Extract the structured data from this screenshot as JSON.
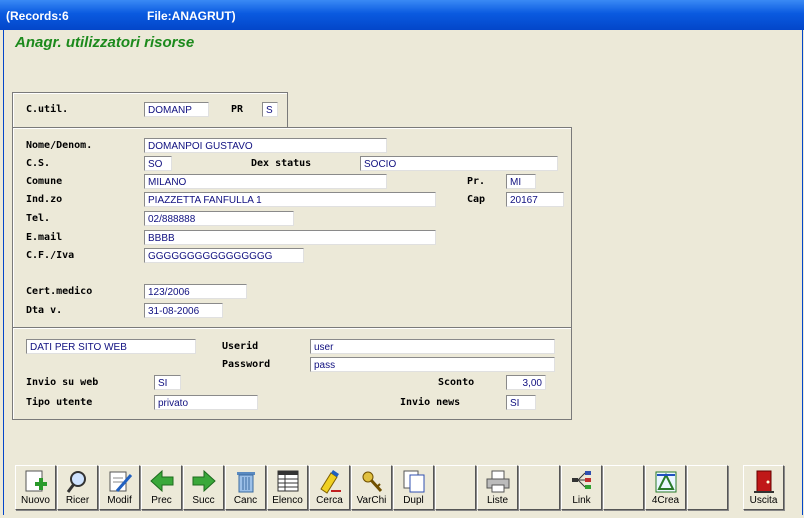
{
  "titlebar": {
    "records": "(Records:6",
    "file": "File:ANAGRUT)"
  },
  "app_title": "Anagr. utilizzatori risorse",
  "header": {
    "cutil_label": "C.util.",
    "cutil_value": "DOMANP",
    "pr_label": "PR",
    "pr_value": "S"
  },
  "main": {
    "nome_label": "Nome/Denom.",
    "nome_value": "DOMANPOI GUSTAVO",
    "cs_label": "C.S.",
    "cs_value": "SO",
    "dexstatus_label": "Dex status",
    "dexstatus_value": "SOCIO",
    "comune_label": "Comune",
    "comune_value": "MILANO",
    "prov_label": "Pr.",
    "prov_value": "MI",
    "indzo_label": "Ind.zo",
    "indzo_value": "PIAZZETTA FANFULLA 1",
    "cap_label": "Cap",
    "cap_value": "20167",
    "tel_label": "Tel.",
    "tel_value": "02/888888",
    "email_label": "E.mail",
    "email_value": "BBBB",
    "cfiva_label": "C.F./Iva",
    "cfiva_value": "GGGGGGGGGGGGGGGG",
    "cert_label": "Cert.medico",
    "cert_value": "123/2006",
    "dta_label": "Dta v.",
    "dta_value": "31-08-2006"
  },
  "web": {
    "section_value": "DATI PER SITO WEB",
    "userid_label": "Userid",
    "userid_value": "user",
    "password_label": "Password",
    "password_value": "pass",
    "invio_web_label": "Invio su web",
    "invio_web_value": "SI",
    "sconto_label": "Sconto",
    "sconto_value": "3,00",
    "tipo_label": "Tipo utente",
    "tipo_value": "privato",
    "news_label": "Invio news",
    "news_value": "SI"
  },
  "toolbar": {
    "nuovo": "Nuovo",
    "ricer": "Ricer",
    "modif": "Modif",
    "prec": "Prec",
    "succ": "Succ",
    "canc": "Canc",
    "elenco": "Elenco",
    "cerca": "Cerca",
    "varchi": "VarChi",
    "dupl": "Dupl",
    "liste": "Liste",
    "link": "Link",
    "crea4": "4Crea",
    "uscita": "Uscita"
  },
  "icons": {
    "nuovo": "new-document-icon",
    "ricer": "magnifier-icon",
    "modif": "edit-document-icon",
    "prec": "arrow-left-icon",
    "succ": "arrow-right-icon",
    "canc": "trash-icon",
    "elenco": "list-icon",
    "cerca": "highlighter-icon",
    "varchi": "keys-icon",
    "dupl": "duplicate-icon",
    "liste": "printer-icon",
    "link": "link-tree-icon",
    "crea4": "crea-icon",
    "uscita": "exit-door-icon"
  },
  "colors": {
    "title_green": "#1c8a1c",
    "field_text": "#101080",
    "titlebar_blue": "#0a5ae0"
  }
}
